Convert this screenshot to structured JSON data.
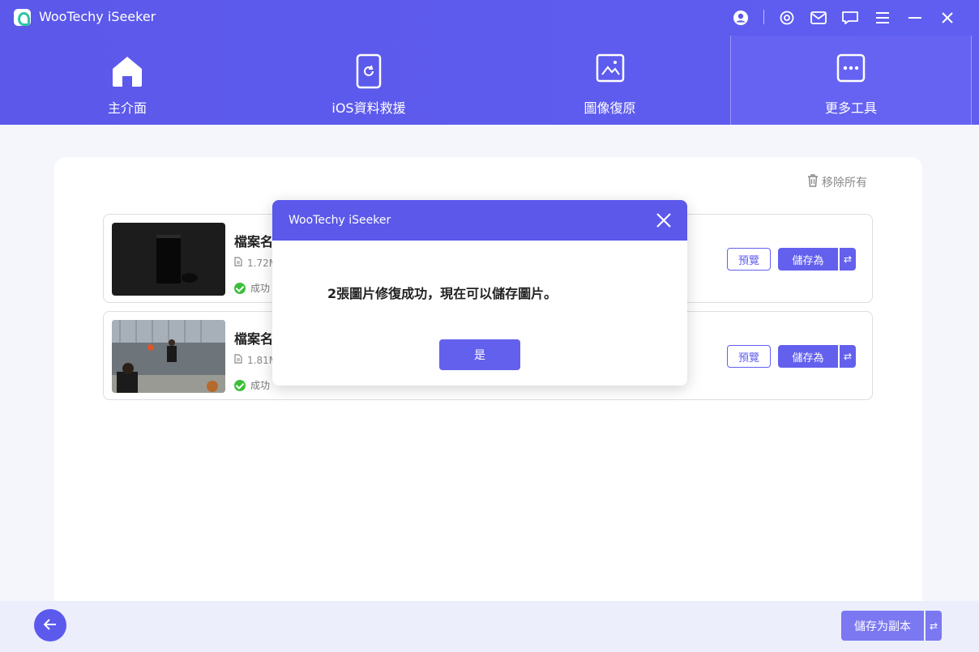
{
  "app": {
    "title": "WooTechy iSeeker"
  },
  "titlebar_icons": [
    "user-icon",
    "settings-icon",
    "mail-icon",
    "feedback-icon",
    "menu-icon",
    "minimize-icon",
    "close-icon"
  ],
  "nav": {
    "items": [
      {
        "label": "主介面",
        "icon": "home-icon"
      },
      {
        "label": "iOS資料救援",
        "icon": "phone-recover-icon"
      },
      {
        "label": "圖像復原",
        "icon": "image-icon"
      },
      {
        "label": "更多工具",
        "icon": "more-icon"
      }
    ],
    "active": "更多工具"
  },
  "main": {
    "remove_all": "移除所有",
    "files": [
      {
        "name": "檔案名",
        "size": "1.72M",
        "status": "成功",
        "preview": "預覽",
        "save_as": "儲存為",
        "swap": "⇄"
      },
      {
        "name": "檔案名",
        "size": "1.81M",
        "status": "成功",
        "preview": "預覽",
        "save_as": "儲存為",
        "swap": "⇄"
      }
    ]
  },
  "footer": {
    "save_copy": "儲存为副本",
    "swap": "⇄"
  },
  "dialog": {
    "title": "WooTechy iSeeker",
    "message": "2張圖片修復成功，現在可以儲存圖片。",
    "ok": "是"
  },
  "colors": {
    "accent": "#5b58ea",
    "success": "#3cbf3a"
  }
}
